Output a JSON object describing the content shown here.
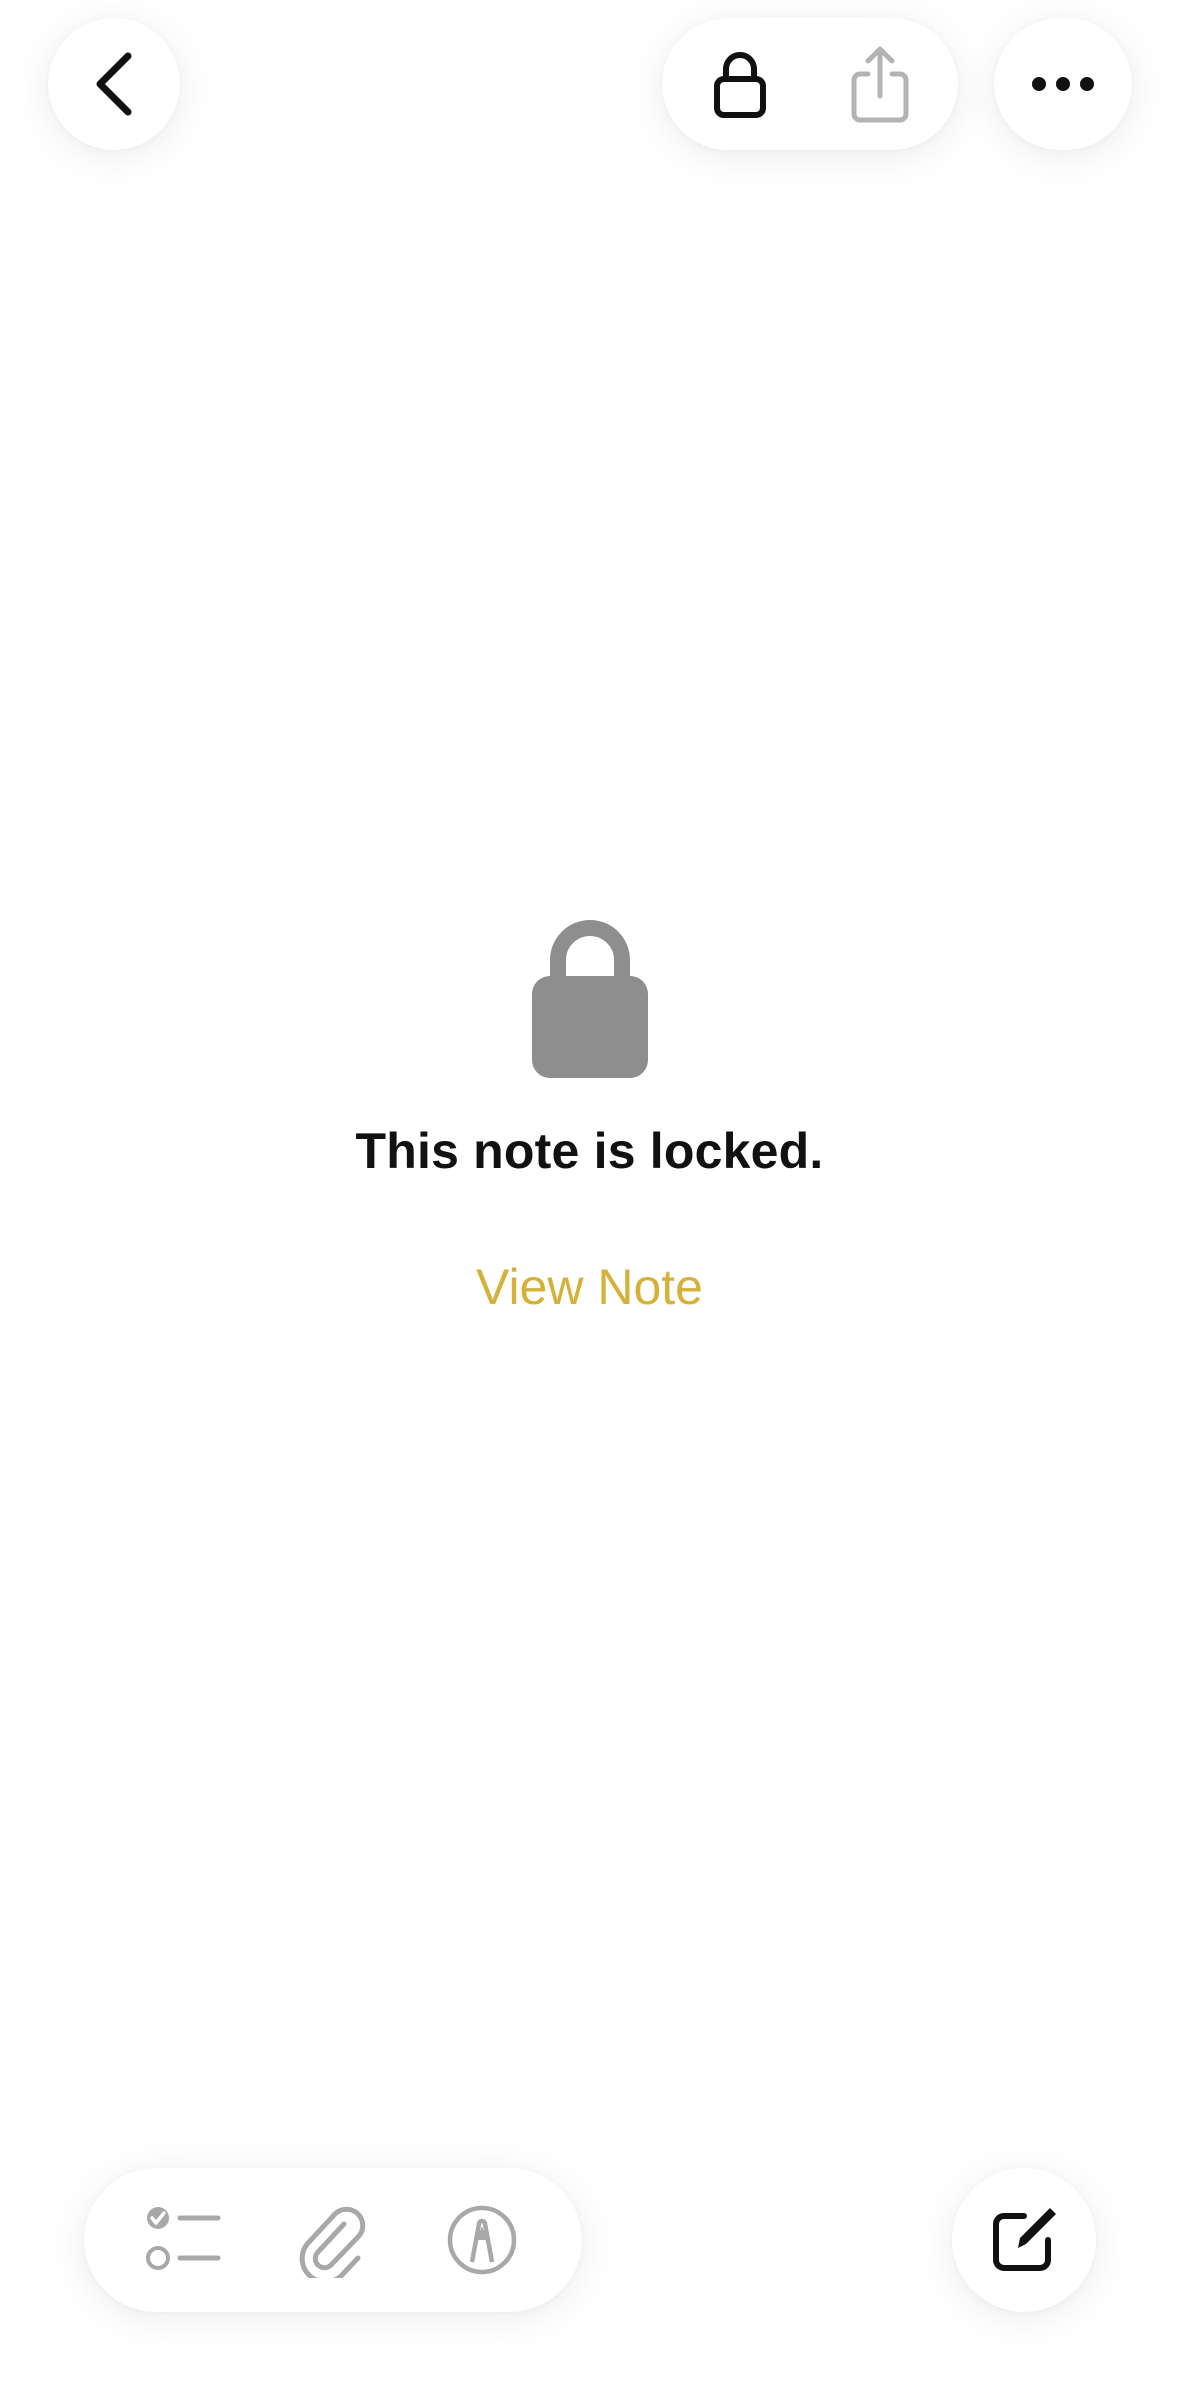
{
  "header": {
    "back_icon": "chevron-left-icon",
    "lock_icon": "lock-icon",
    "share_icon": "share-icon",
    "more_icon": "ellipsis-icon"
  },
  "locked_state": {
    "icon": "lock-fill-icon",
    "title": "This note is locked.",
    "action_label": "View Note",
    "icon_color": "#8e8e8e",
    "accent_color": "#d6b13a"
  },
  "toolbar": {
    "checklist_icon": "checklist-icon",
    "attachment_icon": "paperclip-icon",
    "markup_icon": "pen-markup-icon",
    "compose_icon": "compose-icon"
  }
}
